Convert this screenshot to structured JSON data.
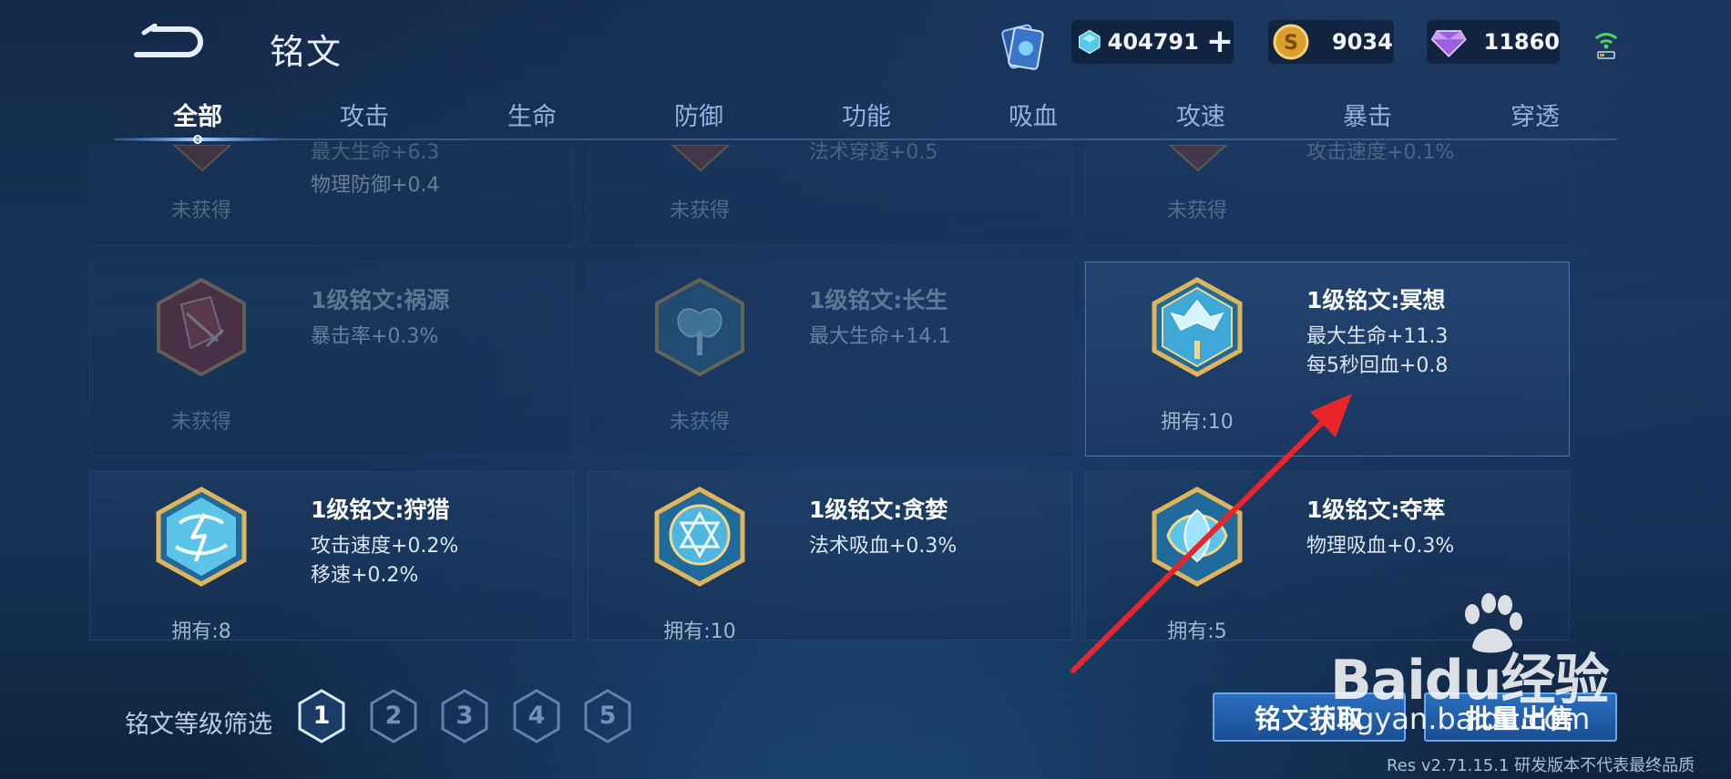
{
  "header": {
    "title": "铭文",
    "resources": {
      "gems": "404791",
      "coins": "9034",
      "diamonds": "11860"
    }
  },
  "tabs": [
    "全部",
    "攻击",
    "生命",
    "防御",
    "功能",
    "吸血",
    "攻速",
    "暴击",
    "穿透"
  ],
  "active_tab": "全部",
  "top_row": {
    "cards": [
      {
        "stat_top": "最大生命+6.3",
        "stat": "物理防御+0.4",
        "status": "未获得"
      },
      {
        "stat_top": "法术穿透+0.5",
        "status": "未获得"
      },
      {
        "stat_top": "攻击速度+0.1%",
        "status": "未获得"
      }
    ]
  },
  "middle_row": {
    "cards": [
      {
        "name": "1级铭文:祸源",
        "stats": [
          "暴击率+0.3%"
        ],
        "status": "未获得"
      },
      {
        "name": "1级铭文:长生",
        "stats": [
          "最大生命+14.1"
        ],
        "status": "未获得"
      },
      {
        "name": "1级铭文:冥想",
        "stats": [
          "最大生命+11.3",
          "每5秒回血+0.8"
        ],
        "status": "拥有:10"
      }
    ]
  },
  "bottom_row": {
    "cards": [
      {
        "name": "1级铭文:狩猎",
        "stats": [
          "攻击速度+0.2%",
          "移速+0.2%"
        ],
        "status": "拥有:8"
      },
      {
        "name": "1级铭文:贪婪",
        "stats": [
          "法术吸血+0.3%"
        ],
        "status": "拥有:10"
      },
      {
        "name": "1级铭文:夺萃",
        "stats": [
          "物理吸血+0.3%"
        ],
        "status": "拥有:5"
      }
    ]
  },
  "filter": {
    "label": "铭文等级筛选",
    "levels": [
      "1",
      "2",
      "3",
      "4",
      "5"
    ],
    "selected": "1"
  },
  "buttons": {
    "obtain": "铭文获取",
    "batch_sell": "批量出售"
  },
  "version": "Res v2.71.15.1 研发版本不代表最终品质",
  "watermark": {
    "brand": "Baidu经验",
    "url": "jingyan.baidu.com"
  },
  "colors": {
    "accent": "#2a6fc0",
    "gold": "#d8b25a",
    "arrow": "#e8262a"
  }
}
